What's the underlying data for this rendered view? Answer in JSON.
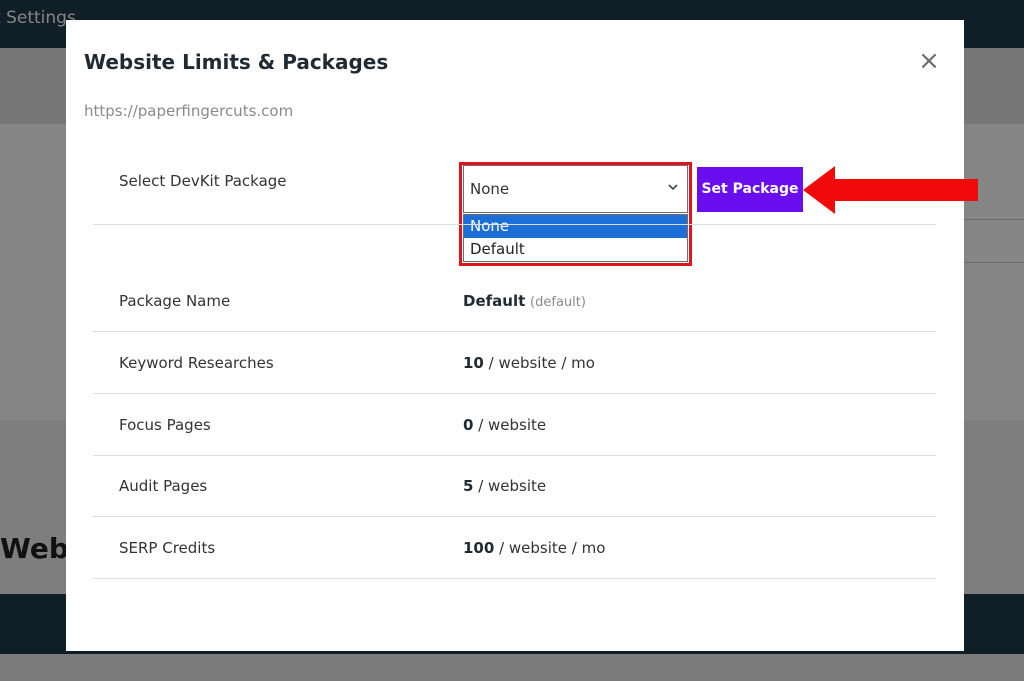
{
  "background": {
    "topbar_text": "t Settings",
    "heading_fragment": "Webs"
  },
  "modal": {
    "title": "Website Limits & Packages",
    "close_icon": "×",
    "url": "https://paperfingercuts.com",
    "select": {
      "label": "Select DevKit Package",
      "value": "None",
      "options": [
        "None",
        "Default"
      ],
      "highlighted_option": "None"
    },
    "set_package_label": "Set Package",
    "rows": [
      {
        "label": "Package Name",
        "value": "Default",
        "suffix": "(default)"
      },
      {
        "label": "Keyword Researches",
        "value": "10",
        "suffix": "/ website / mo"
      },
      {
        "label": "Focus Pages",
        "value": "0",
        "suffix": "/ website"
      },
      {
        "label": "Audit Pages",
        "value": "5",
        "suffix": "/ website"
      },
      {
        "label": "SERP Credits",
        "value": "100",
        "suffix": "/ website / mo"
      }
    ]
  },
  "colors": {
    "accent_button": "#6a0ef0",
    "highlight_border": "#e0141e",
    "arrow": "#f00a0a",
    "option_selected": "#1b6fd6"
  },
  "icons": [
    "close-icon",
    "chevron-down-icon",
    "arrow-left-annotation"
  ]
}
